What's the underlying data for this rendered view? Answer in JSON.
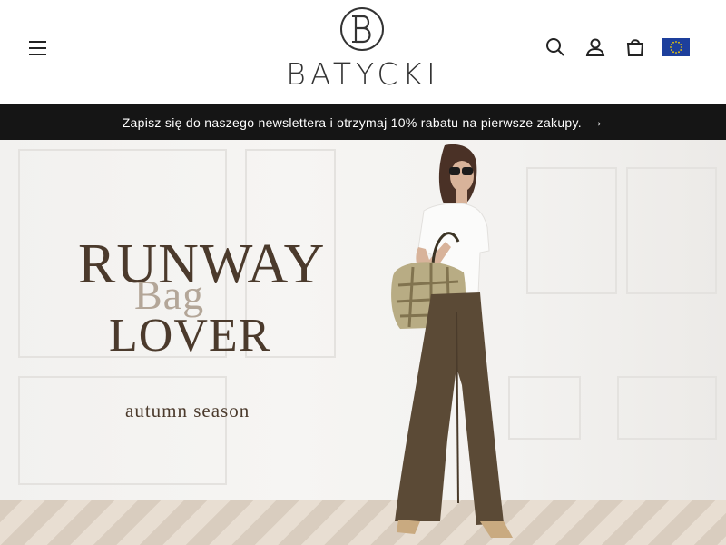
{
  "header": {
    "logo_text": "BATYCKI",
    "logo_monogram": "B",
    "icons": [
      "menu-icon",
      "search-icon",
      "account-icon",
      "cart-icon",
      "eu-flag-icon"
    ]
  },
  "announcement": {
    "text": "Zapisz się do naszego newslettera i otrzymaj 10% rabatu na pierwsze zakupy.",
    "arrow": "→"
  },
  "hero": {
    "line1": "RUNWAY",
    "line2": "Bag",
    "line3": "LOVER",
    "subtitle": "autumn season"
  },
  "colors": {
    "announce_bg": "#151515",
    "headline": "#4b3a2c",
    "accent_bag": "#b3a698",
    "flag": "#1d3f9c"
  }
}
